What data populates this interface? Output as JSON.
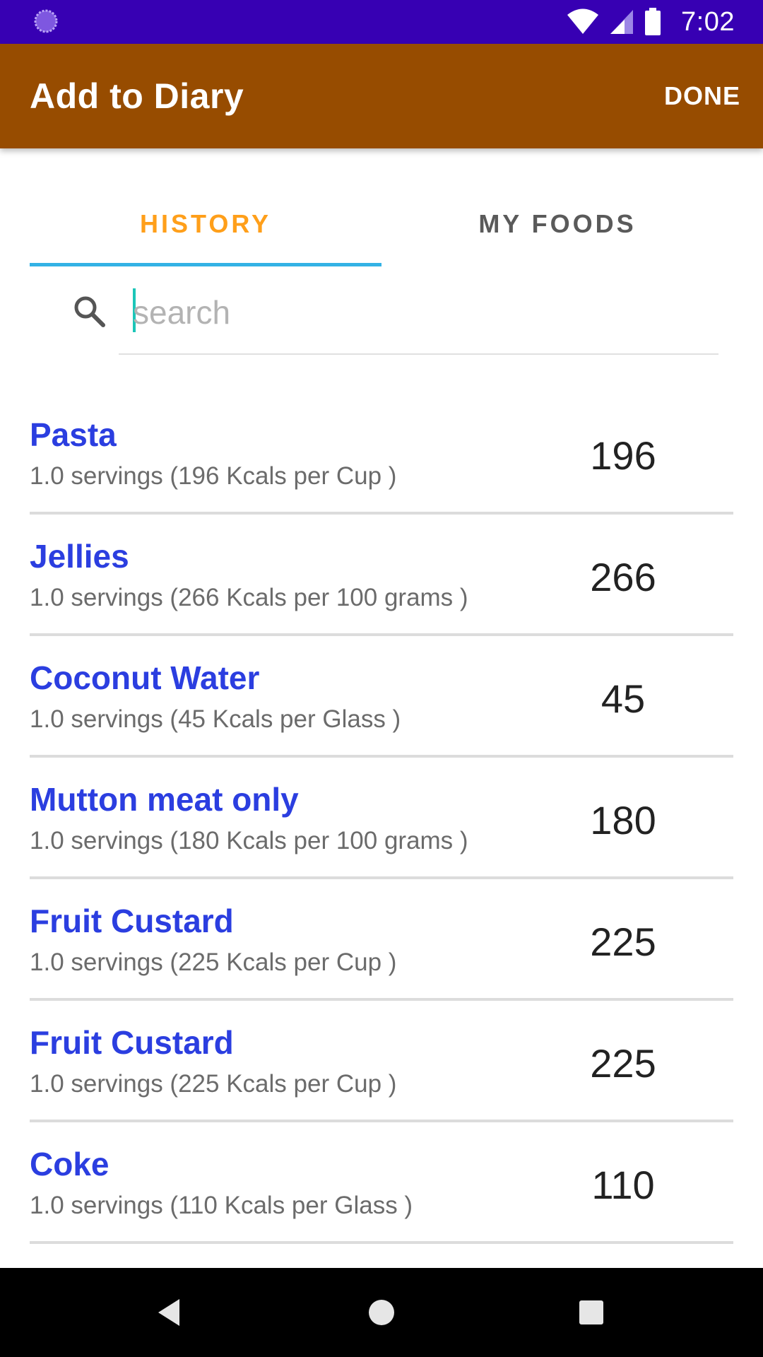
{
  "status_bar": {
    "time": "7:02",
    "icons": [
      "app-indicator-icon",
      "wifi-icon",
      "signal-icon",
      "battery-icon"
    ]
  },
  "app_bar": {
    "title": "Add to Diary",
    "done_label": "DONE",
    "color": "#974c00"
  },
  "tabs": [
    {
      "label": "HISTORY",
      "active": true
    },
    {
      "label": "MY FOODS",
      "active": false
    }
  ],
  "search": {
    "placeholder": "search",
    "value": ""
  },
  "foods": [
    {
      "name": "Pasta",
      "detail": "1.0 servings (196 Kcals per Cup )",
      "kcal": "196"
    },
    {
      "name": "Jellies",
      "detail": "1.0 servings (266 Kcals per 100 grams )",
      "kcal": "266"
    },
    {
      "name": "Coconut Water",
      "detail": "1.0 servings (45 Kcals per Glass )",
      "kcal": "45"
    },
    {
      "name": "Mutton meat only",
      "detail": "1.0 servings (180 Kcals per 100 grams )",
      "kcal": "180"
    },
    {
      "name": "Fruit Custard",
      "detail": "1.0 servings (225 Kcals per Cup )",
      "kcal": "225"
    },
    {
      "name": "Fruit Custard",
      "detail": "1.0 servings (225 Kcals per Cup )",
      "kcal": "225"
    },
    {
      "name": "Coke",
      "detail": "1.0 servings (110 Kcals per Glass )",
      "kcal": "110"
    }
  ],
  "colors": {
    "status_bar": "#3700b3",
    "accent_tab": "#ff9f1a",
    "tab_indicator": "#33b2e5",
    "food_name": "#2b3ee0"
  },
  "nav_bar": {
    "icons": [
      "back-icon",
      "home-icon",
      "recents-icon"
    ]
  }
}
